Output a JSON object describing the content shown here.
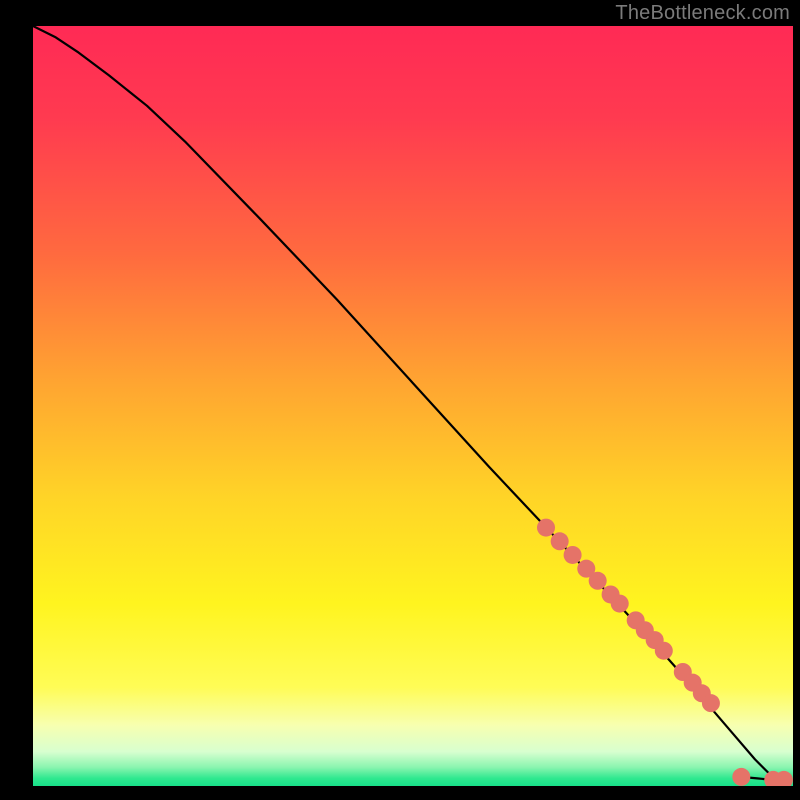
{
  "attribution": "TheBottleneck.com",
  "chart_data": {
    "type": "line",
    "title": "",
    "xlabel": "",
    "ylabel": "",
    "xlim": [
      0,
      100
    ],
    "ylim": [
      0,
      100
    ],
    "background_gradient": {
      "stops": [
        {
          "offset": 0.0,
          "color": "#ff2a55"
        },
        {
          "offset": 0.12,
          "color": "#ff3a50"
        },
        {
          "offset": 0.3,
          "color": "#ff6a3f"
        },
        {
          "offset": 0.47,
          "color": "#ffa531"
        },
        {
          "offset": 0.62,
          "color": "#ffd427"
        },
        {
          "offset": 0.76,
          "color": "#fff41f"
        },
        {
          "offset": 0.87,
          "color": "#fffc56"
        },
        {
          "offset": 0.92,
          "color": "#f7ffb0"
        },
        {
          "offset": 0.955,
          "color": "#d8ffcf"
        },
        {
          "offset": 0.975,
          "color": "#8cf5b0"
        },
        {
          "offset": 0.99,
          "color": "#2ee88f"
        },
        {
          "offset": 1.0,
          "color": "#18e089"
        }
      ]
    },
    "series": [
      {
        "name": "curve",
        "type": "line",
        "color": "#000000",
        "x": [
          0,
          3,
          6,
          10,
          15,
          20,
          30,
          40,
          50,
          60,
          68,
          76,
          82,
          86,
          89,
          92,
          95,
          97,
          98.5
        ],
        "y": [
          100,
          98.5,
          96.5,
          93.5,
          89.5,
          84.8,
          74.5,
          64,
          53,
          42,
          33.5,
          25,
          18.5,
          14,
          10.5,
          7,
          3.5,
          1.5,
          0.6
        ]
      },
      {
        "name": "cluster-points",
        "type": "scatter",
        "color": "#e57368",
        "marker_radius": 9,
        "x": [
          67.5,
          69.3,
          71.0,
          72.8,
          74.3,
          76.0,
          77.2,
          79.3,
          80.5,
          81.8,
          83.0,
          85.5,
          86.8,
          88.0,
          89.2,
          93.2,
          97.4,
          98.8
        ],
        "y": [
          34.0,
          32.2,
          30.4,
          28.6,
          27.0,
          25.2,
          24.0,
          21.8,
          20.5,
          19.2,
          17.8,
          15.0,
          13.6,
          12.2,
          10.9,
          1.2,
          0.8,
          0.8
        ]
      }
    ],
    "tail_segment": {
      "color": "#000000",
      "x": [
        93.2,
        95.3,
        97.4,
        98.8
      ],
      "y": [
        1.2,
        1.0,
        0.8,
        0.8
      ]
    }
  }
}
